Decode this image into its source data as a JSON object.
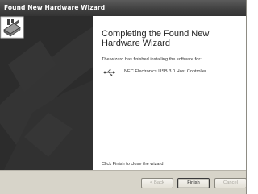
{
  "window": {
    "title": "Found New Hardware Wizard"
  },
  "main": {
    "heading": "Completing the Found New Hardware Wizard",
    "intro": "The wizard has finished installing the software for:",
    "device_name": "NEC Electronics USB 3.0 Host Controller",
    "close_note": "Click Finish to close the wizard."
  },
  "footer": {
    "back_label": "< Back",
    "finish_label": "Finish",
    "cancel_label": "Cancel"
  },
  "icons": {
    "wizard": "hardware-install-icon",
    "device": "usb-icon"
  },
  "colors": {
    "titlebar": "#3f3f3f",
    "sidepanel": "#2c2c2c",
    "dialog_bg": "#d7d4c9"
  }
}
